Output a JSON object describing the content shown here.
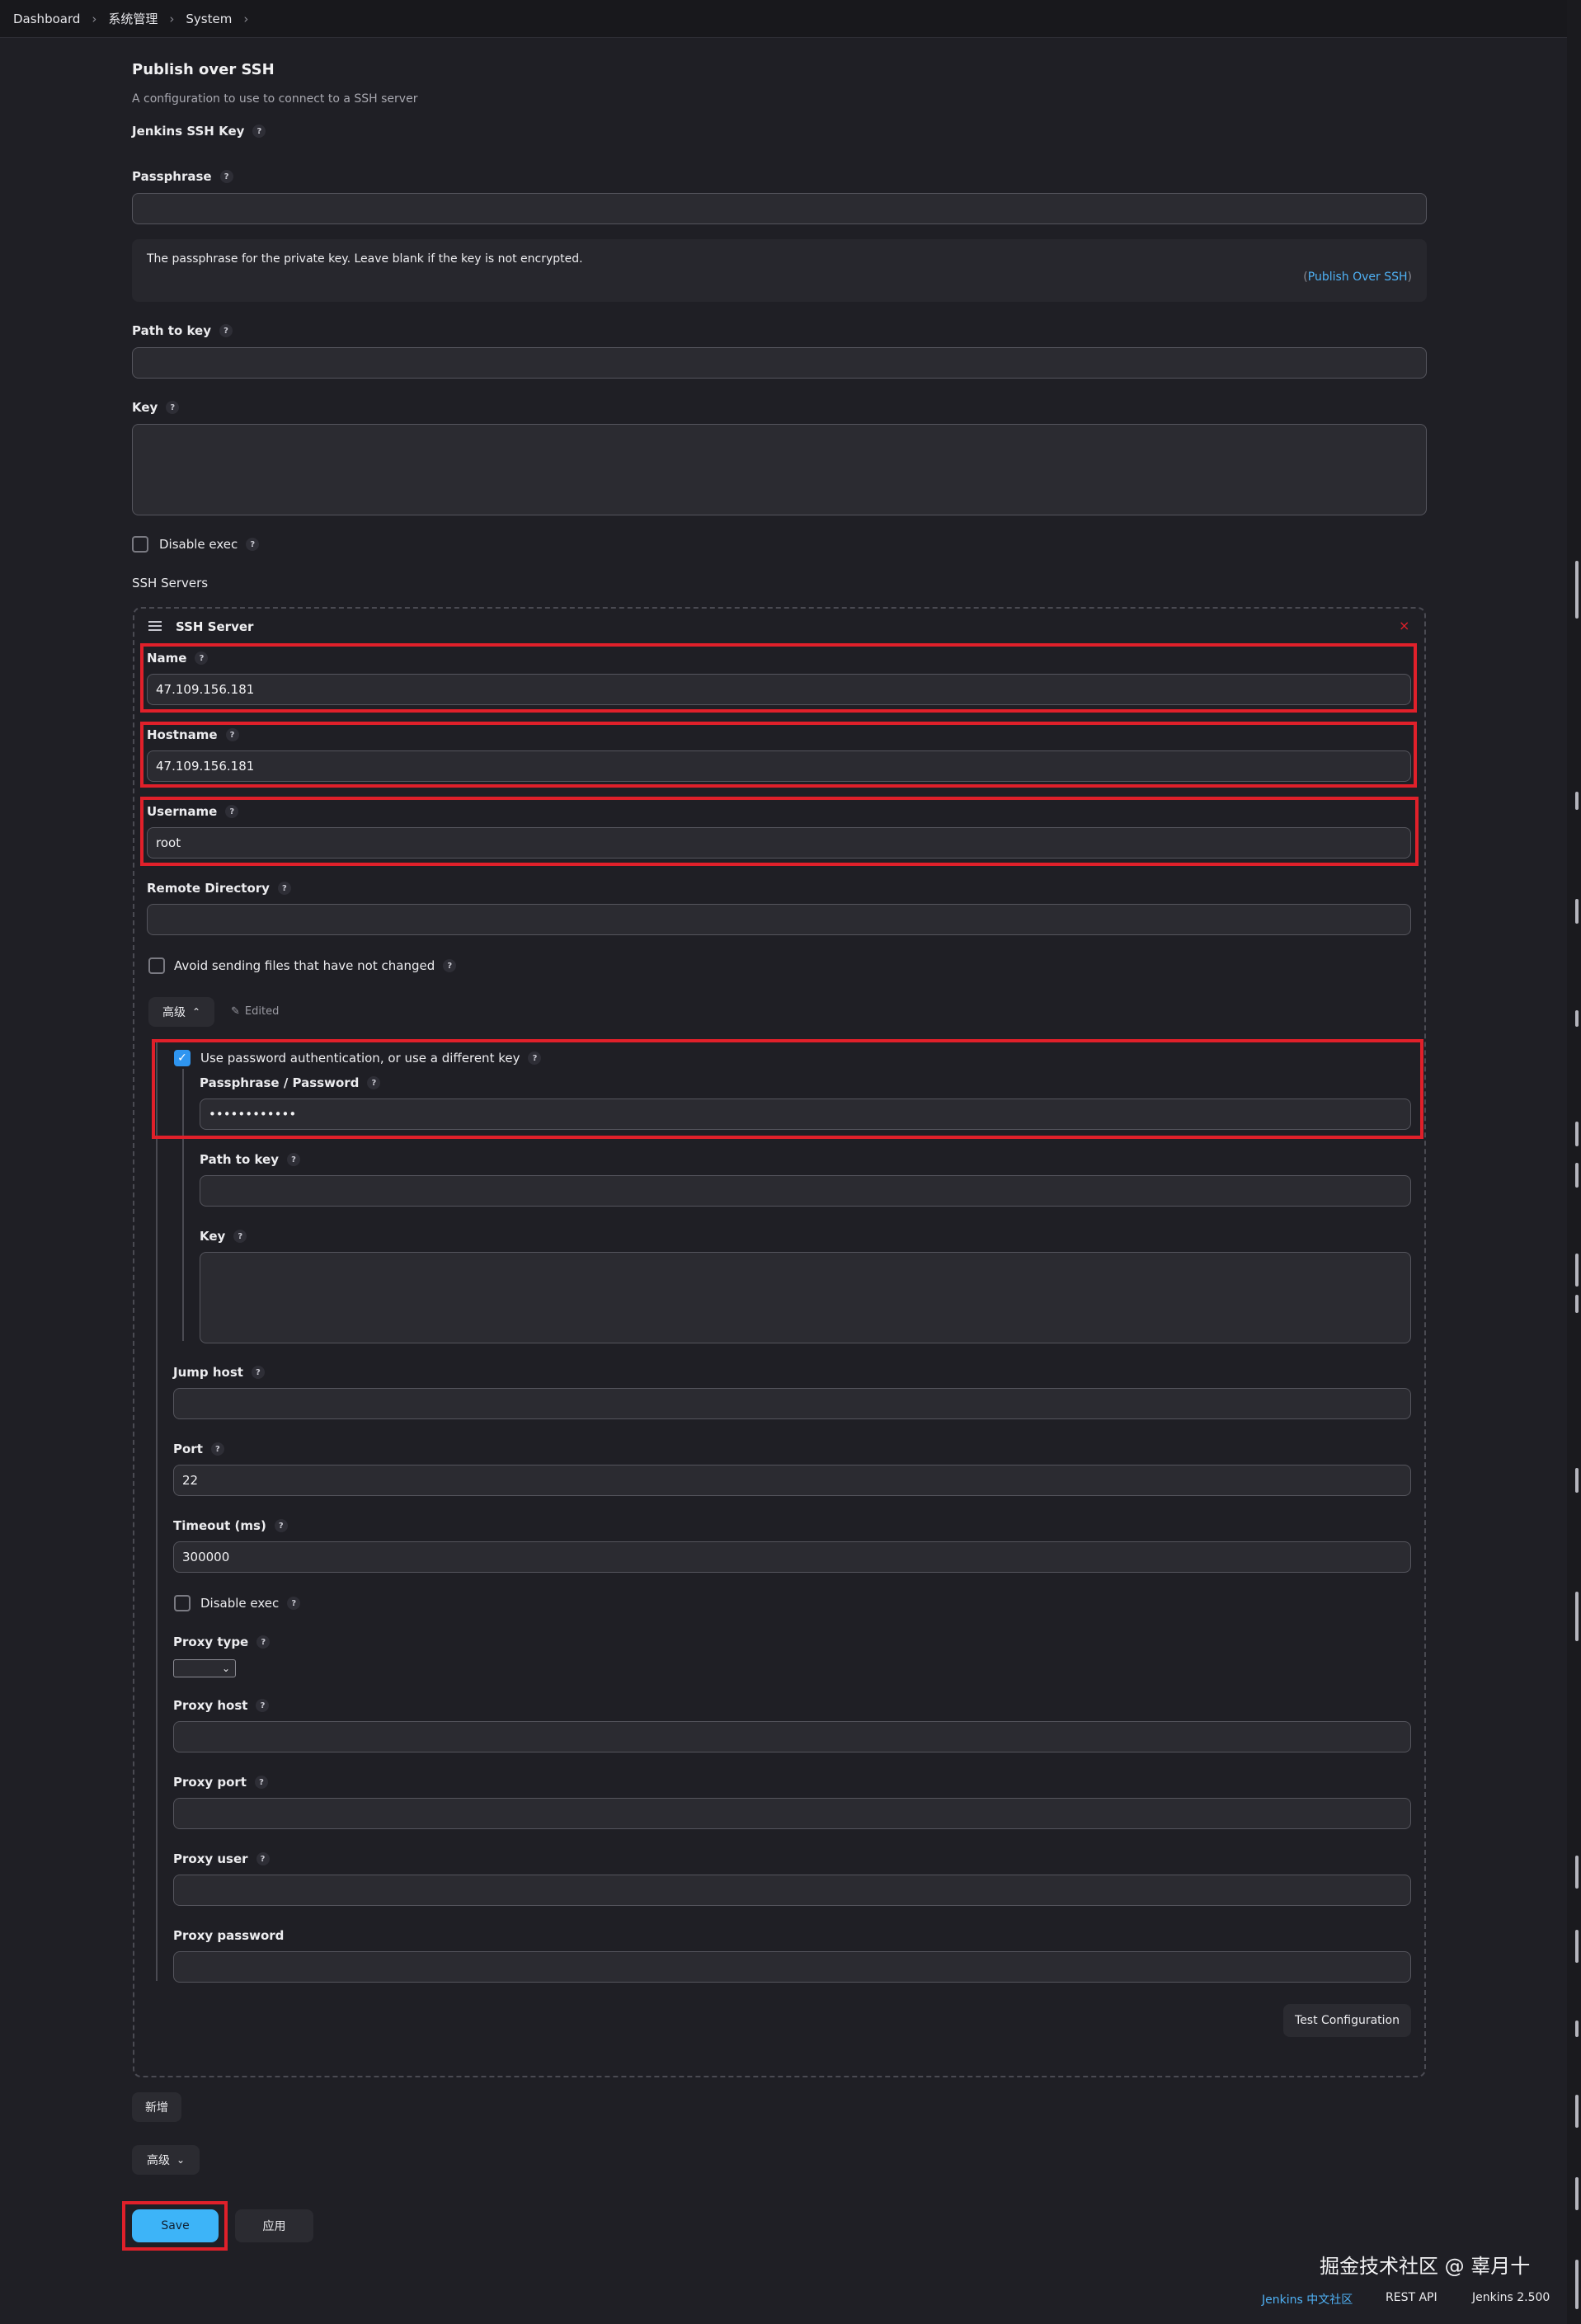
{
  "breadcrumb": {
    "items": [
      "Dashboard",
      "系统管理",
      "System"
    ]
  },
  "publish_over_ssh": {
    "title": "Publish over SSH",
    "description": "A configuration to use to connect to a SSH server",
    "jenkins_ssh_key_label": "Jenkins SSH Key",
    "passphrase_label": "Passphrase",
    "passphrase_value": "",
    "info_text": "The passphrase for the private key. Leave blank if the key is not encrypted.",
    "info_link": "Publish Over SSH",
    "path_to_key_label": "Path to key",
    "path_to_key_value": "",
    "key_label": "Key",
    "disable_exec_label": "Disable exec",
    "ssh_servers_label": "SSH Servers"
  },
  "ssh_server": {
    "header": "SSH Server",
    "name_label": "Name",
    "name_value": "47.109.156.181",
    "hostname_label": "Hostname",
    "hostname_value": "47.109.156.181",
    "username_label": "Username",
    "username_value": "root",
    "remote_directory_label": "Remote Directory",
    "remote_directory_value": "",
    "avoid_sending_label": "Avoid sending files that have not changed",
    "advanced_label": "高级",
    "edited_label": "Edited",
    "use_password_label": "Use password authentication, or use a different key",
    "use_password_checked": true,
    "passphrase_password_label": "Passphrase / Password",
    "passphrase_password_value": "••••••••••••",
    "path_to_key_label": "Path to key",
    "key_label": "Key",
    "jump_host_label": "Jump host",
    "port_label": "Port",
    "port_value": "22",
    "timeout_label": "Timeout (ms)",
    "timeout_value": "300000",
    "disable_exec_label": "Disable exec",
    "proxy_type_label": "Proxy type",
    "proxy_host_label": "Proxy host",
    "proxy_port_label": "Proxy port",
    "proxy_user_label": "Proxy user",
    "proxy_password_label": "Proxy password",
    "test_configuration_label": "Test Configuration"
  },
  "actions": {
    "add_label": "新增",
    "advanced_label": "高级",
    "save_label": "Save",
    "apply_label": "应用"
  },
  "footer": {
    "watermark": "掘金技术社区 @ 辜月十",
    "community_link": "Jenkins 中文社区",
    "rest_api": "REST API",
    "version": "Jenkins 2.500"
  },
  "help_glyph": "?",
  "colors": {
    "accent": "#3db4f8",
    "highlight": "#e0202a",
    "background": "#1f1f25"
  }
}
